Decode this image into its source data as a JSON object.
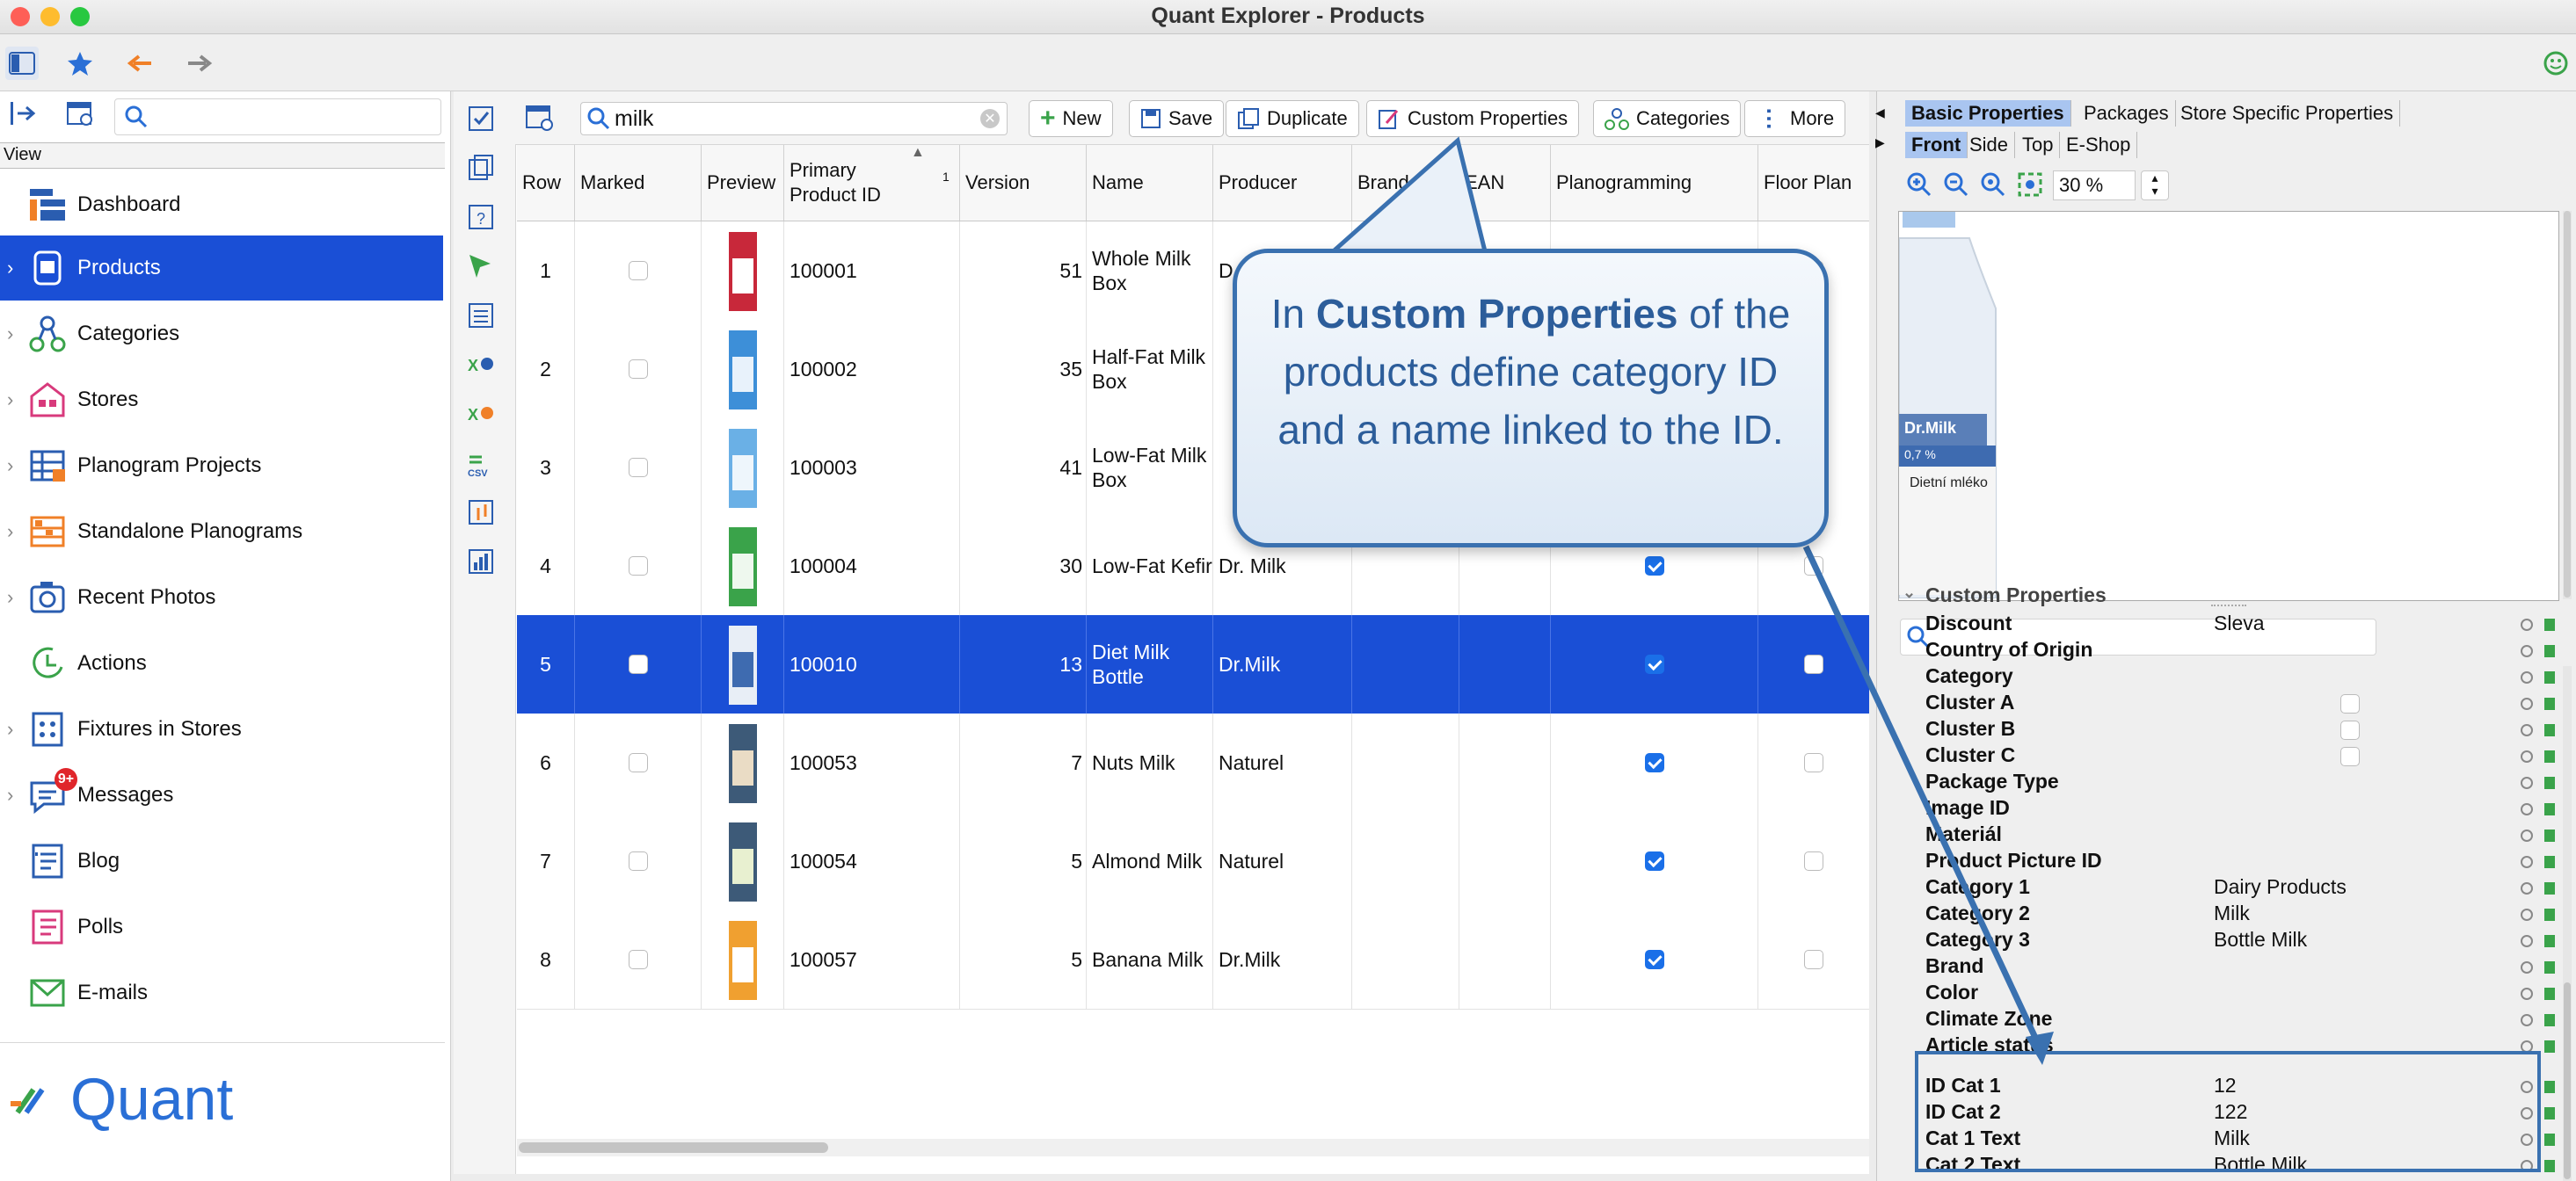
{
  "window": {
    "title": "Quant Explorer - Products"
  },
  "colors": {
    "accent": "#1a4fd6",
    "callout_border": "#3a71b0",
    "callout_text": "#2c5d9a",
    "badge": "#e0262b"
  },
  "nav": {
    "view_label": "View",
    "items": [
      {
        "label": "Dashboard",
        "icon": "dashboard-icon"
      },
      {
        "label": "Products",
        "icon": "products-icon"
      },
      {
        "label": "Categories",
        "icon": "categories-icon"
      },
      {
        "label": "Stores",
        "icon": "stores-icon"
      },
      {
        "label": "Planogram Projects",
        "icon": "planogram-projects-icon"
      },
      {
        "label": "Standalone Planograms",
        "icon": "standalone-planograms-icon"
      },
      {
        "label": "Recent Photos",
        "icon": "camera-icon"
      },
      {
        "label": "Actions",
        "icon": "actions-icon"
      },
      {
        "label": "Fixtures in Stores",
        "icon": "fixtures-icon"
      },
      {
        "label": "Messages",
        "icon": "messages-icon",
        "badge": "9+"
      },
      {
        "label": "Blog",
        "icon": "blog-icon"
      },
      {
        "label": "Polls",
        "icon": "polls-icon"
      },
      {
        "label": "E-mails",
        "icon": "email-icon"
      }
    ],
    "logo_text": "Quant"
  },
  "toolbar": {
    "search_value": "milk",
    "buttons": [
      "New",
      "Save",
      "Duplicate",
      "Custom Properties",
      "Categories",
      "More"
    ]
  },
  "table": {
    "columns": [
      "Row",
      "Marked",
      "Preview",
      "Primary Product ID",
      "Version",
      "Name",
      "Producer",
      "Brand",
      "EAN",
      "Planogramming",
      "Floor Plan"
    ],
    "sort_indicator": "1",
    "rows": [
      {
        "row": "1",
        "id": "100001",
        "version": "51",
        "name": "Whole Milk Box",
        "producer": "D",
        "plan": false
      },
      {
        "row": "2",
        "id": "100002",
        "version": "35",
        "name": "Half-Fat Milk Box",
        "producer": "",
        "plan": false
      },
      {
        "row": "3",
        "id": "100003",
        "version": "41",
        "name": "Low-Fat Milk Box",
        "producer": "",
        "plan": false
      },
      {
        "row": "4",
        "id": "100004",
        "version": "30",
        "name": "Low-Fat Kefir",
        "producer": "Dr. Milk",
        "plan": true
      },
      {
        "row": "5",
        "id": "100010",
        "version": "13",
        "name": "Diet Milk Bottle",
        "producer": "Dr.Milk",
        "plan": true
      },
      {
        "row": "6",
        "id": "100053",
        "version": "7",
        "name": "Nuts Milk",
        "producer": "Naturel",
        "plan": true
      },
      {
        "row": "7",
        "id": "100054",
        "version": "5",
        "name": "Almond Milk",
        "producer": "Naturel",
        "plan": true
      },
      {
        "row": "8",
        "id": "100057",
        "version": "5",
        "name": "Banana Milk",
        "producer": "Dr.Milk",
        "plan": true
      }
    ]
  },
  "right": {
    "tabs1": [
      "Basic Properties",
      "Packages",
      "Store Specific Properties"
    ],
    "tabs2": [
      "Front",
      "Side",
      "Top",
      "E-Shop"
    ],
    "zoom": "30 %",
    "preview": {
      "brand": "Dr.Milk",
      "fat": "0,7 %",
      "subtitle": "Dietní mléko"
    },
    "section_title": "Custom Properties",
    "props": [
      {
        "name": "Discount",
        "value": "Sleva"
      },
      {
        "name": "Country of Origin",
        "value": ""
      },
      {
        "name": "Category",
        "value": ""
      },
      {
        "name": "Cluster A",
        "value": "",
        "checkbox": true
      },
      {
        "name": "Cluster B",
        "value": "",
        "checkbox": true
      },
      {
        "name": "Cluster C",
        "value": "",
        "checkbox": true
      },
      {
        "name": "Package Type",
        "value": ""
      },
      {
        "name": "Image ID",
        "value": ""
      },
      {
        "name": "Materiál",
        "value": ""
      },
      {
        "name": "Product Picture ID",
        "value": ""
      },
      {
        "name": "Category 1",
        "value": "Dairy Products"
      },
      {
        "name": "Category 2",
        "value": "Milk"
      },
      {
        "name": "Category 3",
        "value": "Bottle Milk"
      },
      {
        "name": "Brand",
        "value": ""
      },
      {
        "name": "Color",
        "value": ""
      },
      {
        "name": "Climate Zone",
        "value": ""
      },
      {
        "name": "Article status",
        "value": ""
      },
      {
        "name": "ID Cat 1",
        "value": "12"
      },
      {
        "name": "ID Cat 2",
        "value": "122"
      },
      {
        "name": "Cat 1 Text",
        "value": "Milk"
      },
      {
        "name": "Cat 2 Text",
        "value": "Bottle Milk"
      }
    ]
  },
  "callout": {
    "pre": "In ",
    "bold": "Custom Properties",
    "post": " of the products define category ID and a name linked to the ID."
  }
}
